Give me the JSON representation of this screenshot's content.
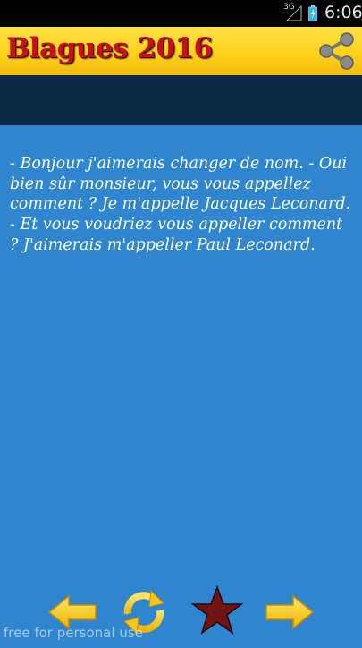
{
  "status_bar": {
    "network": "3G",
    "time": "6:06"
  },
  "header": {
    "title": "Blagues 2016",
    "share_icon": "share-icon",
    "title_color": "#c4111a",
    "bar_color": "#ffd21c"
  },
  "content": {
    "joke": "- Bonjour j'aimerais changer de nom. - Oui bien sûr monsieur, vous vous appellez comment ? Je m'appelle Jacques Leconard. - Et vous voudriez vous appeller comment ? J'aimerais m'appeller Paul Leconard."
  },
  "bottom_bar": {
    "icons": [
      "arrow-left-icon",
      "refresh-icon",
      "star-icon",
      "arrow-right-icon"
    ]
  },
  "watermark": "free for personal use",
  "colors": {
    "background": "#2f86cf",
    "band": "#0c2a47",
    "arrow": "#ffcc00",
    "star": "#6e1414"
  }
}
